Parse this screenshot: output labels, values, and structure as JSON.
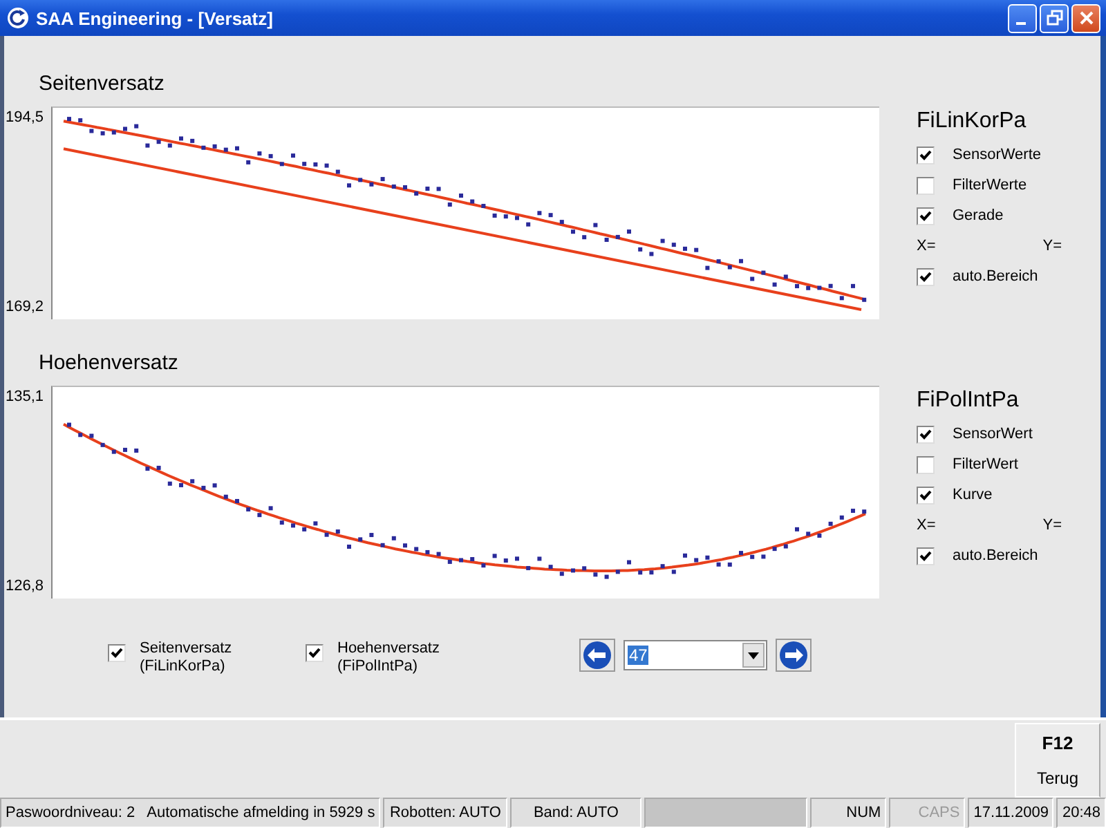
{
  "window": {
    "title": "SAA Engineering - [Versatz]"
  },
  "charts": [
    {
      "title": "Seitenversatz",
      "y_max": "194,5",
      "y_min": "169,2",
      "kind": "linear",
      "panel": {
        "title": "FiLinKorPa",
        "options": [
          {
            "label": "SensorWerte",
            "checked": true
          },
          {
            "label": "FilterWerte",
            "checked": false
          },
          {
            "label": "Gerade",
            "checked": true
          }
        ],
        "x_label": "X=",
        "y_label": "Y=",
        "auto_range": {
          "label": "auto.Bereich",
          "checked": true
        }
      }
    },
    {
      "title": "Hoehenversatz",
      "y_max": "135,1",
      "y_min": "126,8",
      "kind": "curve",
      "panel": {
        "title": "FiPolIntPa",
        "options": [
          {
            "label": "SensorWert",
            "checked": true
          },
          {
            "label": "FilterWert",
            "checked": false
          },
          {
            "label": "Kurve",
            "checked": true
          }
        ],
        "x_label": "X=",
        "y_label": "Y=",
        "auto_range": {
          "label": "auto.Bereich",
          "checked": true
        }
      }
    }
  ],
  "series_toggles": [
    {
      "label": "Seitenversatz",
      "sublabel": "(FiLinKorPa)",
      "checked": true
    },
    {
      "label": "Hoehenversatz",
      "sublabel": "(FiPolIntPa)",
      "checked": true
    }
  ],
  "navigator": {
    "value": "47"
  },
  "function_key": {
    "key": "F12",
    "label": "Terug"
  },
  "status_bar": {
    "panels": [
      "Paswoordniveau: 2   Automatische afmelding in 5929 s",
      "Robotten: AUTO",
      "Band: AUTO"
    ],
    "key_indicators": [
      {
        "label": "NUM",
        "on": true
      },
      {
        "label": "CAPS",
        "on": false
      }
    ],
    "date": "17.11.2009",
    "time": "20:48"
  }
}
